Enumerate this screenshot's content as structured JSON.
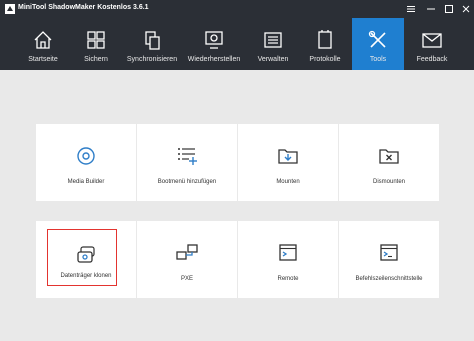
{
  "window": {
    "title": "MiniTool ShadowMaker Kostenlos 3.6.1"
  },
  "nav": {
    "items": [
      {
        "label": "Startseite",
        "icon": "home-icon"
      },
      {
        "label": "Sichern",
        "icon": "backup-icon"
      },
      {
        "label": "Synchronisieren",
        "icon": "sync-icon"
      },
      {
        "label": "Wiederherstellen",
        "icon": "restore-icon"
      },
      {
        "label": "Verwalten",
        "icon": "manage-icon"
      },
      {
        "label": "Protokolle",
        "icon": "logs-icon"
      },
      {
        "label": "Tools",
        "icon": "tools-icon",
        "active": true
      },
      {
        "label": "Feedback",
        "icon": "mail-icon"
      }
    ]
  },
  "tools": {
    "row1": [
      {
        "label": "Media Builder",
        "icon": "disc-icon"
      },
      {
        "label": "Bootmenü hinzufügen",
        "icon": "boot-menu-icon"
      },
      {
        "label": "Mounten",
        "icon": "mount-folder-icon"
      },
      {
        "label": "Dismounten",
        "icon": "dismount-folder-icon"
      }
    ],
    "row2": [
      {
        "label": "Datenträger klonen",
        "icon": "clone-disk-icon",
        "highlighted": true
      },
      {
        "label": "PXE",
        "icon": "network-icon"
      },
      {
        "label": "Remote",
        "icon": "terminal-icon"
      },
      {
        "label": "Befehlszeilenschnittstelle",
        "icon": "command-line-icon"
      }
    ]
  },
  "colors": {
    "titlebar": "#2b2f36",
    "accent": "#1f7fd0",
    "background": "#e9e9e9",
    "highlight": "#e3342f"
  }
}
